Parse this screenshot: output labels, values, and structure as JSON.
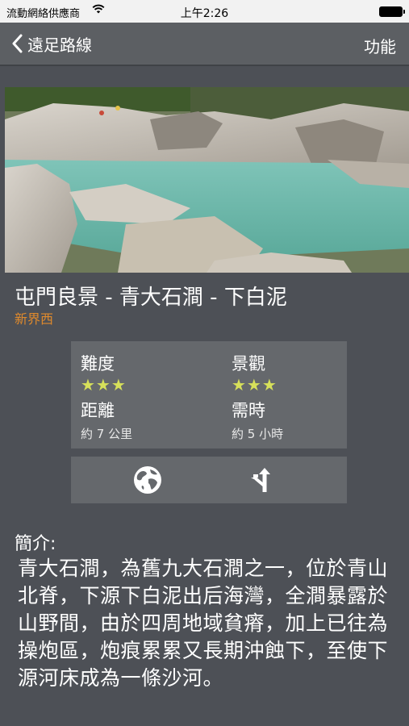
{
  "status_bar": {
    "carrier": "流動網絡供應商",
    "time": "上午2:26"
  },
  "nav": {
    "back_label": "遠足路線",
    "right_label": "功能"
  },
  "route": {
    "title": "屯門良景 - 青大石澗 - 下白泥",
    "region": "新界西",
    "difficulty_label": "難度",
    "difficulty_stars": "★★★",
    "scenery_label": "景觀",
    "scenery_stars": "★★★",
    "distance_label": "距離",
    "distance_value": "約 7 公里",
    "duration_label": "需時",
    "duration_value": "約 5 小時"
  },
  "intro": {
    "label": "簡介:",
    "text": "青大石澗，為舊九大石澗之一，位於青山北脊，下源下白泥出后海灣，全澗暴露於山野間，由於四周地域貧瘠，加上已往為操炮區，炮痕累累又長期沖蝕下，至使下源河床成為一條沙河。"
  },
  "colors": {
    "background": "#4d5056",
    "panel": "#65686c",
    "accent": "#e08a2c",
    "stars": "#d7e05a"
  },
  "icons": {
    "back": "chevron-left-icon",
    "map": "globe-icon",
    "directions": "directions-icon",
    "wifi": "wifi-icon",
    "battery": "battery-icon"
  }
}
